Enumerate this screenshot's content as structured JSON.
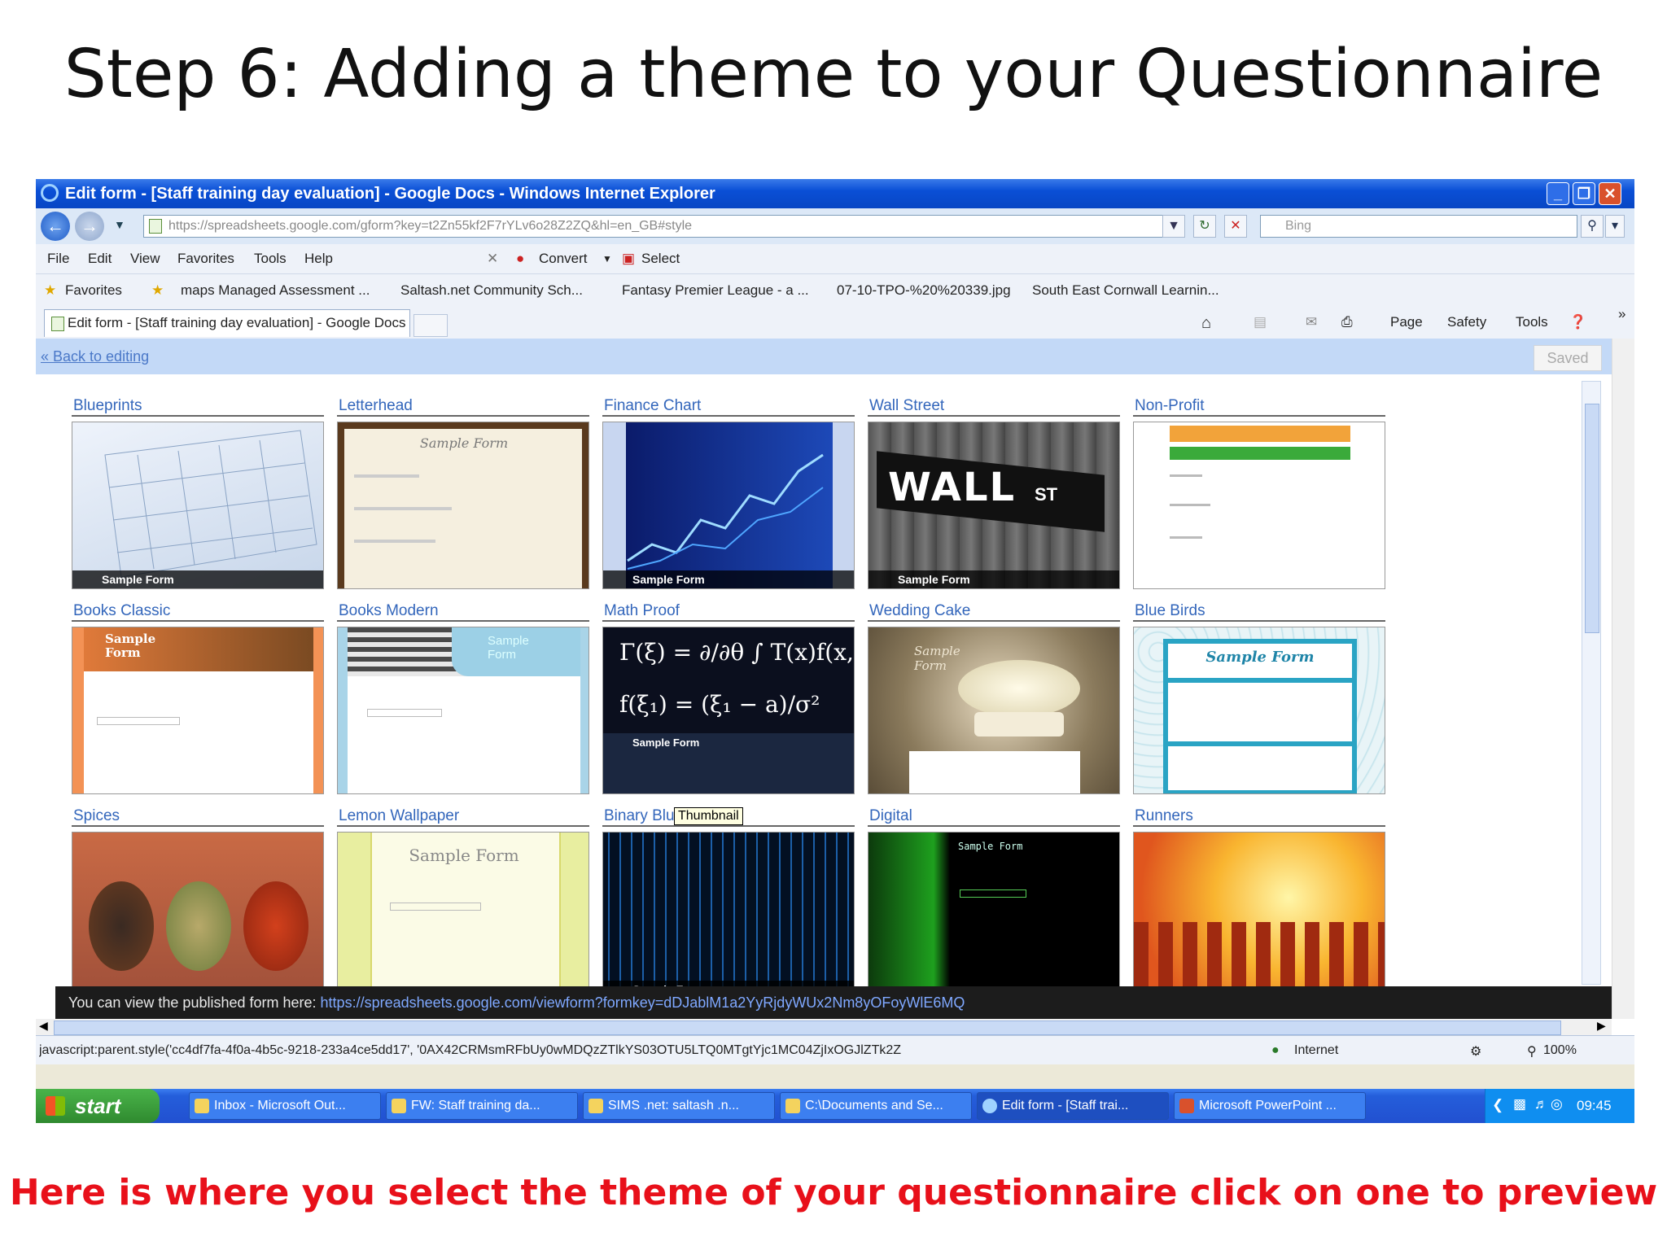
{
  "slide": {
    "title": "Step 6: Adding a theme to your Questionnaire",
    "caption": "Here is where you select the theme of your questionnaire click on one to preview"
  },
  "window": {
    "title": "Edit form - [Staff training day evaluation] - Google Docs - Windows Internet Explorer",
    "minimize": "_",
    "restore": "❐",
    "close": "✕"
  },
  "address": {
    "url": "https://spreadsheets.google.com/gform?key=t2Zn55kf2F7rYLv6o28Z2ZQ&hl=en_GB#style",
    "search_placeholder": "Bing"
  },
  "menu": [
    "File",
    "Edit",
    "View",
    "Favorites",
    "Tools",
    "Help"
  ],
  "addon": {
    "convert": "Convert",
    "select": "Select"
  },
  "favorites": {
    "label": "Favorites",
    "items": [
      "maps Managed Assessment ...",
      "Saltash.net Community Sch...",
      "Fantasy Premier League - a ...",
      "07-10-TPO-%20%20339.jpg",
      "South East Cornwall Learnin..."
    ]
  },
  "tab": {
    "label": "Edit form - [Staff training day evaluation] - Google Docs"
  },
  "command_bar": {
    "page": "Page",
    "safety": "Safety",
    "tools": "Tools"
  },
  "editor": {
    "back_link": "« Back to editing",
    "saved": "Saved",
    "tooltip": "Thumbnail",
    "sample_form": "Sample Form",
    "themes": [
      {
        "name": "Blueprints"
      },
      {
        "name": "Letterhead"
      },
      {
        "name": "Finance Chart"
      },
      {
        "name": "Wall Street"
      },
      {
        "name": "Non-Profit"
      },
      {
        "name": "Books Classic"
      },
      {
        "name": "Books Modern"
      },
      {
        "name": "Math Proof"
      },
      {
        "name": "Wedding Cake"
      },
      {
        "name": "Blue Birds"
      },
      {
        "name": "Spices"
      },
      {
        "name": "Lemon Wallpaper"
      },
      {
        "name": "Binary Blu"
      },
      {
        "name": "Digital"
      },
      {
        "name": "Runners"
      }
    ],
    "wall_text": "WALL",
    "wall_st": "ST",
    "published_label": "You can view the published form here:",
    "published_url": "https://spreadsheets.google.com/viewform?formkey=dDJablM1a2YyRjdyWUx2Nm8yOFoyWlE6MQ"
  },
  "status": {
    "script": "javascript:parent.style('cc4df7fa-4f0a-4b5c-9218-233a4ce5dd17', '0AX42CRMsmRFbUy0wMDQzZTlkYS03OTU5LTQ0MTgtYjc1MC04ZjIxOGJlZTk2Z",
    "zone": "Internet",
    "zoom": "100%"
  },
  "taskbar": {
    "start": "start",
    "tasks": [
      "Inbox - Microsoft Out...",
      "FW: Staff training da...",
      "SIMS .net: saltash .n...",
      "C:\\Documents and Se...",
      "Edit form - [Staff trai...",
      "Microsoft PowerPoint ..."
    ],
    "clock": "09:45"
  }
}
